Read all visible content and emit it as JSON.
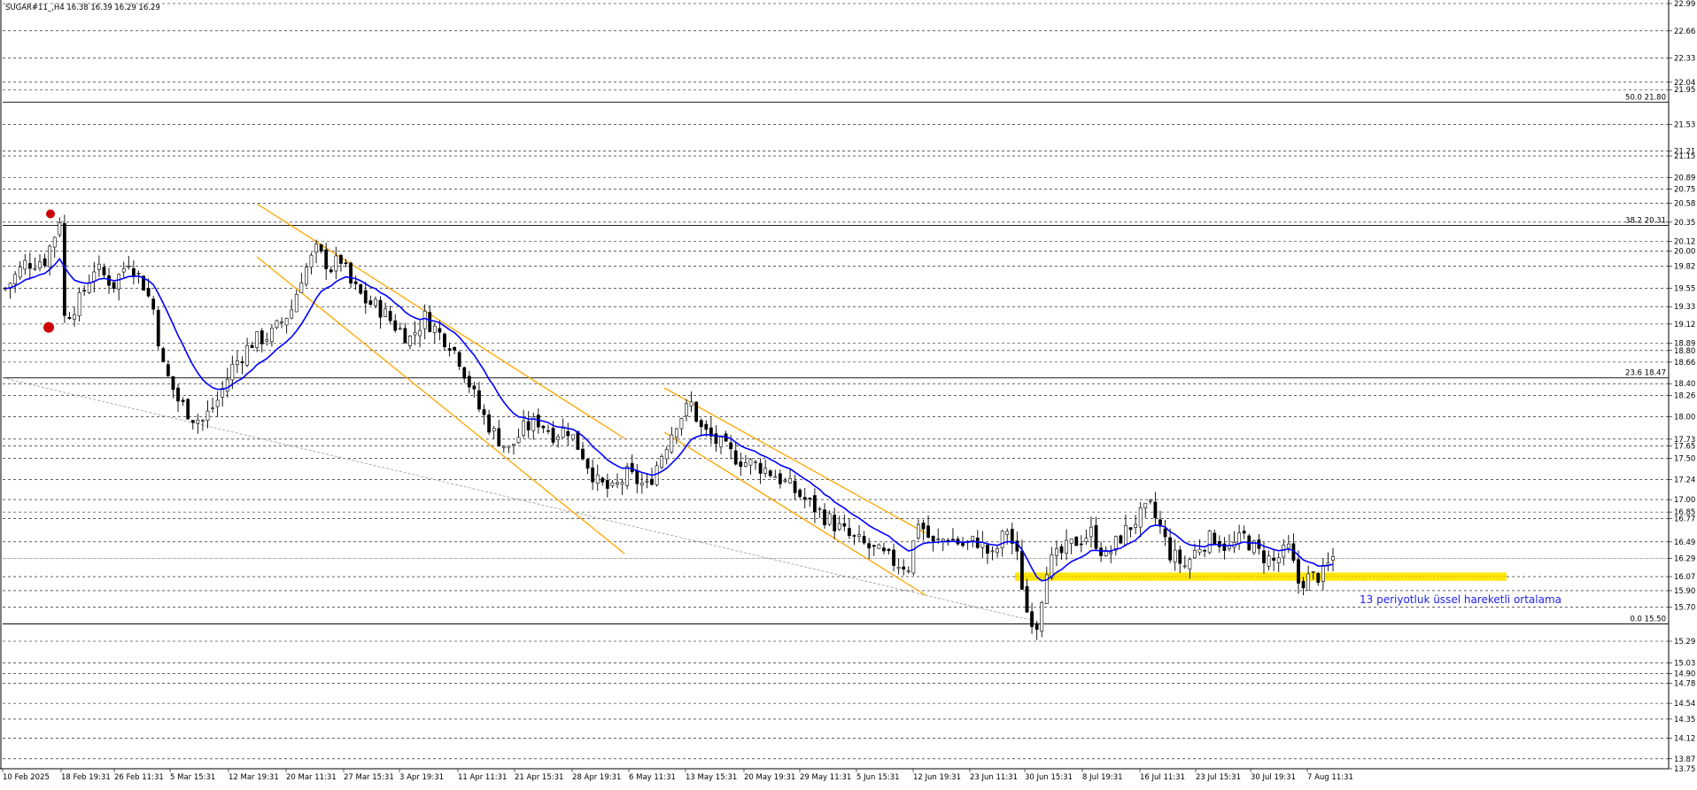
{
  "header": {
    "info": "SUGAR#11_,H4  16.38 16.39 16.29 16.29"
  },
  "annotation": {
    "ema_label": "13 periyotluk üssel hareketli ortalama"
  },
  "colors": {
    "ema": "#0000ff",
    "channel": "#ffa500",
    "support": "#ffe600",
    "candle": "#000000",
    "marker": "#cc0000",
    "fib": "#000000",
    "trend": "#999999"
  },
  "chart_data": {
    "type": "candlestick",
    "symbol": "SUGAR#11_",
    "timeframe": "H4",
    "ylim": [
      13.75,
      22.99
    ],
    "y_tick_labels": [
      "22.99",
      "22.66",
      "22.33",
      "22.04",
      "21.95",
      "21.53",
      "21.21",
      "21.15",
      "20.89",
      "20.75",
      "20.58",
      "20.35",
      "20.12",
      "20.00",
      "19.82",
      "19.55",
      "19.33",
      "19.12",
      "18.89",
      "18.80",
      "18.66",
      "18.40",
      "18.26",
      "18.00",
      "17.73",
      "17.65",
      "17.50",
      "17.24",
      "17.00",
      "16.85",
      "16.77",
      "16.49",
      "16.29",
      "16.07",
      "15.90",
      "15.70",
      "15.29",
      "15.03",
      "14.90",
      "14.78",
      "14.54",
      "14.35",
      "14.12",
      "13.87",
      "13.75"
    ],
    "x_tick_labels": [
      "10 Feb 2025",
      "18 Feb 19:31",
      "26 Feb 11:31",
      "5 Mar 15:31",
      "12 Mar 19:31",
      "20 Mar 11:31",
      "27 Mar 15:31",
      "3 Apr 19:31",
      "11 Apr 11:31",
      "21 Apr 15:31",
      "28 Apr 19:31",
      "6 May 11:31",
      "13 May 15:31",
      "20 May 19:31",
      "29 May 11:31",
      "5 Jun 15:31",
      "12 Jun 19:31",
      "23 Jun 11:31",
      "30 Jun 15:31",
      "8 Jul 19:31",
      "16 Jul 11:31",
      "23 Jul 15:31",
      "30 Jul 19:31",
      "7 Aug 11:31"
    ],
    "fibonacci": [
      {
        "label": "50.0 21.80",
        "value": 21.8
      },
      {
        "label": "38.2 20.31",
        "value": 20.31
      },
      {
        "label": "23.6 18.47",
        "value": 18.47
      },
      {
        "label": "0.0 15.50",
        "value": 15.5
      }
    ],
    "support_zone": [
      16.02,
      16.12
    ],
    "current_price": 16.29,
    "close_path": [
      [
        0,
        19.55
      ],
      [
        4,
        19.85
      ],
      [
        8,
        19.9
      ],
      [
        10,
        20.2
      ],
      [
        11,
        20.4
      ],
      [
        12,
        19.2
      ],
      [
        15,
        19.4
      ],
      [
        18,
        19.8
      ],
      [
        22,
        19.6
      ],
      [
        25,
        19.9
      ],
      [
        28,
        19.6
      ],
      [
        30,
        19.3
      ],
      [
        32,
        18.6
      ],
      [
        35,
        18.2
      ],
      [
        38,
        18.0
      ],
      [
        40,
        17.95
      ],
      [
        43,
        18.2
      ],
      [
        46,
        18.6
      ],
      [
        50,
        18.9
      ],
      [
        54,
        19.0
      ],
      [
        58,
        19.3
      ],
      [
        60,
        19.7
      ],
      [
        63,
        20.0
      ],
      [
        66,
        19.8
      ],
      [
        68,
        19.9
      ],
      [
        70,
        19.6
      ],
      [
        73,
        19.4
      ],
      [
        76,
        19.3
      ],
      [
        79,
        19.1
      ],
      [
        82,
        18.95
      ],
      [
        85,
        19.2
      ],
      [
        88,
        19.0
      ],
      [
        90,
        18.9
      ],
      [
        92,
        18.7
      ],
      [
        94,
        18.4
      ],
      [
        96,
        18.1
      ],
      [
        99,
        17.8
      ],
      [
        102,
        17.6
      ],
      [
        105,
        17.85
      ],
      [
        108,
        17.95
      ],
      [
        111,
        17.8
      ],
      [
        114,
        17.85
      ],
      [
        117,
        17.55
      ],
      [
        120,
        17.2
      ],
      [
        123,
        17.1
      ],
      [
        126,
        17.3
      ],
      [
        130,
        17.15
      ],
      [
        133,
        17.55
      ],
      [
        136,
        17.95
      ],
      [
        139,
        18.15
      ],
      [
        141,
        17.85
      ],
      [
        144,
        17.7
      ],
      [
        147,
        17.55
      ],
      [
        150,
        17.45
      ],
      [
        153,
        17.4
      ],
      [
        156,
        17.3
      ],
      [
        159,
        17.15
      ],
      [
        162,
        17.0
      ],
      [
        165,
        16.85
      ],
      [
        168,
        16.7
      ],
      [
        171,
        16.55
      ],
      [
        174,
        16.45
      ],
      [
        177,
        16.35
      ],
      [
        180,
        16.25
      ],
      [
        183,
        16.2
      ],
      [
        185,
        16.75
      ],
      [
        188,
        16.45
      ],
      [
        191,
        16.55
      ],
      [
        194,
        16.45
      ],
      [
        197,
        16.5
      ],
      [
        200,
        16.3
      ],
      [
        203,
        16.65
      ],
      [
        205,
        16.3
      ],
      [
        207,
        15.65
      ],
      [
        209,
        15.5
      ],
      [
        211,
        16.2
      ],
      [
        214,
        16.35
      ],
      [
        217,
        16.5
      ],
      [
        220,
        16.6
      ],
      [
        223,
        16.3
      ],
      [
        226,
        16.55
      ],
      [
        229,
        16.75
      ],
      [
        232,
        16.9
      ],
      [
        234,
        16.65
      ],
      [
        236,
        16.35
      ],
      [
        239,
        16.2
      ],
      [
        242,
        16.45
      ],
      [
        245,
        16.55
      ],
      [
        248,
        16.4
      ],
      [
        251,
        16.55
      ],
      [
        254,
        16.35
      ],
      [
        257,
        16.25
      ],
      [
        260,
        16.4
      ],
      [
        262,
        16.0
      ],
      [
        264,
        16.05
      ],
      [
        267,
        16.1
      ],
      [
        269,
        16.3
      ]
    ],
    "series": [
      {
        "name": "13 periyotluk üssel hareketli ortalama",
        "type": "ema",
        "period": 13
      }
    ]
  }
}
